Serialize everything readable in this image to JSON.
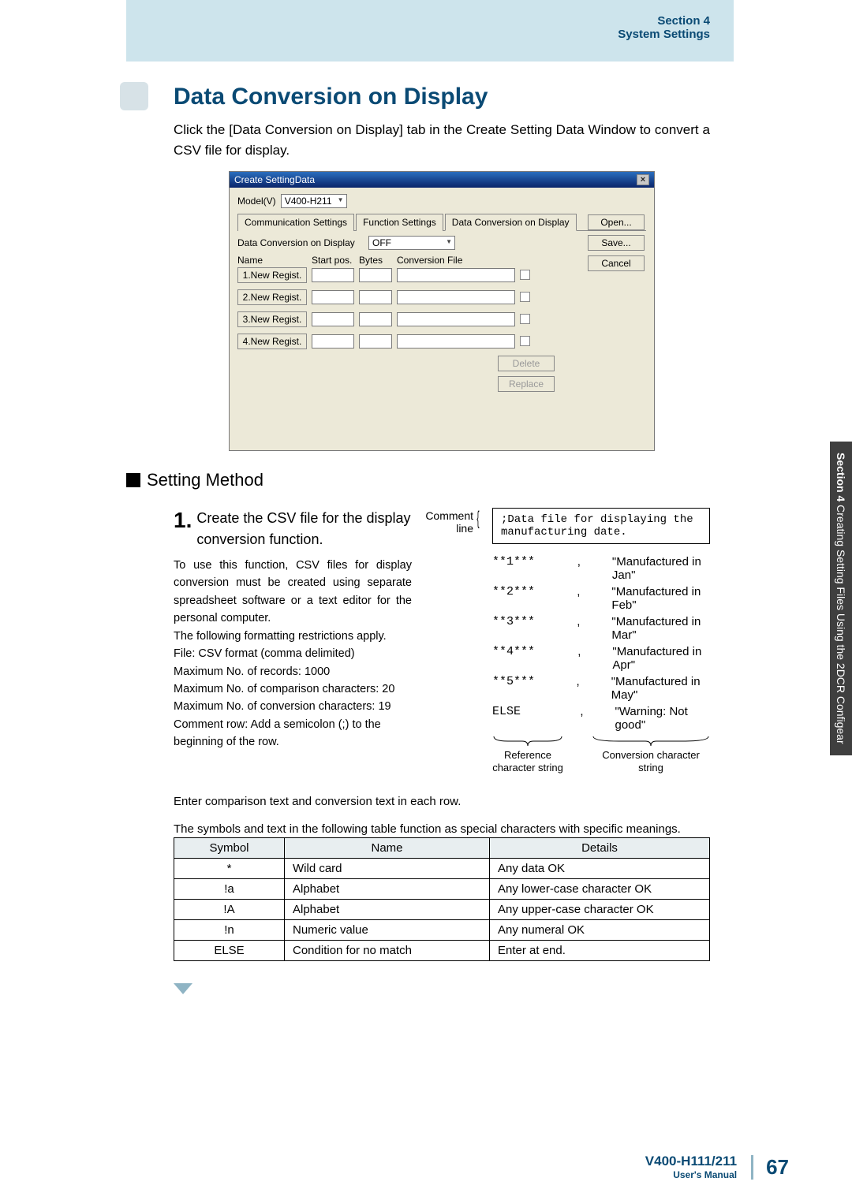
{
  "header": {
    "section_label": "Section 4",
    "section_title": "System Settings"
  },
  "main": {
    "heading": "Data Conversion on Display",
    "intro": "Click the [Data Conversion on Display] tab in the Create Setting Data Window to convert a CSV file for display."
  },
  "dialog": {
    "title": "Create SettingData",
    "model_label": "Model(V)",
    "model_value": "V400-H211",
    "tabs": [
      "Communication Settings",
      "Function Settings",
      "Data Conversion on Display"
    ],
    "dcd_label": "Data Conversion on Display",
    "dcd_value": "OFF",
    "columns": {
      "name": "Name",
      "start": "Start pos.",
      "bytes": "Bytes",
      "file": "Conversion File"
    },
    "rows": [
      "1.New Regist.",
      "2.New Regist.",
      "3.New Regist.",
      "4.New Regist."
    ],
    "buttons": {
      "open": "Open...",
      "save": "Save...",
      "cancel": "Cancel",
      "delete": "Delete",
      "replace": "Replace"
    }
  },
  "setting_method": {
    "title": "Setting Method"
  },
  "step1": {
    "number": "1.",
    "title": "Create the CSV file for the display conversion function.",
    "body1": "To use this function, CSV files for display conversion must be created using separate spreadsheet software or a text editor for the personal computer.",
    "body2": "The following formatting restrictions apply.",
    "body3": "File: CSV format (comma delimited)",
    "body4": "Maximum No. of records: 1000",
    "body5": "Maximum No. of comparison characters: 20",
    "body6": "Maximum No. of conversion characters: 19",
    "body7": "Comment row: Add a semicolon (;) to the beginning of the row.",
    "comment_label": "Comment line",
    "data_comment": ";Data file for displaying the manufacturing date.",
    "rows": [
      {
        "ref": "**1***",
        "conv": "\"Manufactured in Jan\""
      },
      {
        "ref": "**2***",
        "conv": "\"Manufactured in Feb\""
      },
      {
        "ref": "**3***",
        "conv": "\"Manufactured in Mar\""
      },
      {
        "ref": "**4***",
        "conv": "\"Manufactured in Apr\""
      },
      {
        "ref": "**5***",
        "conv": "\"Manufactured in May\""
      },
      {
        "ref": "ELSE",
        "conv": "\"Warning: Not good\""
      }
    ],
    "ref_label": "Reference character string",
    "conv_label": "Conversion character string"
  },
  "compare_text": "Enter comparison text and conversion text in each row.",
  "table_caption": "The symbols and text in the following table function as special characters with specific meanings.",
  "table": {
    "headers": {
      "symbol": "Symbol",
      "name": "Name",
      "details": "Details"
    },
    "rows": [
      {
        "symbol": "*",
        "name": "Wild card",
        "details": "Any data OK"
      },
      {
        "symbol": "!a",
        "name": "Alphabet",
        "details": "Any lower-case character OK"
      },
      {
        "symbol": "!A",
        "name": "Alphabet",
        "details": "Any upper-case character OK"
      },
      {
        "symbol": "!n",
        "name": "Numeric value",
        "details": "Any numeral OK"
      },
      {
        "symbol": "ELSE",
        "name": "Condition for no match",
        "details": "Enter at end."
      }
    ]
  },
  "footer": {
    "model": "V400-H111/211",
    "manual": "User's Manual",
    "page": "67"
  },
  "side_tab": {
    "bold": "Section 4",
    "rest": "  Creating Setting Files Using the 2DCR Configear"
  }
}
